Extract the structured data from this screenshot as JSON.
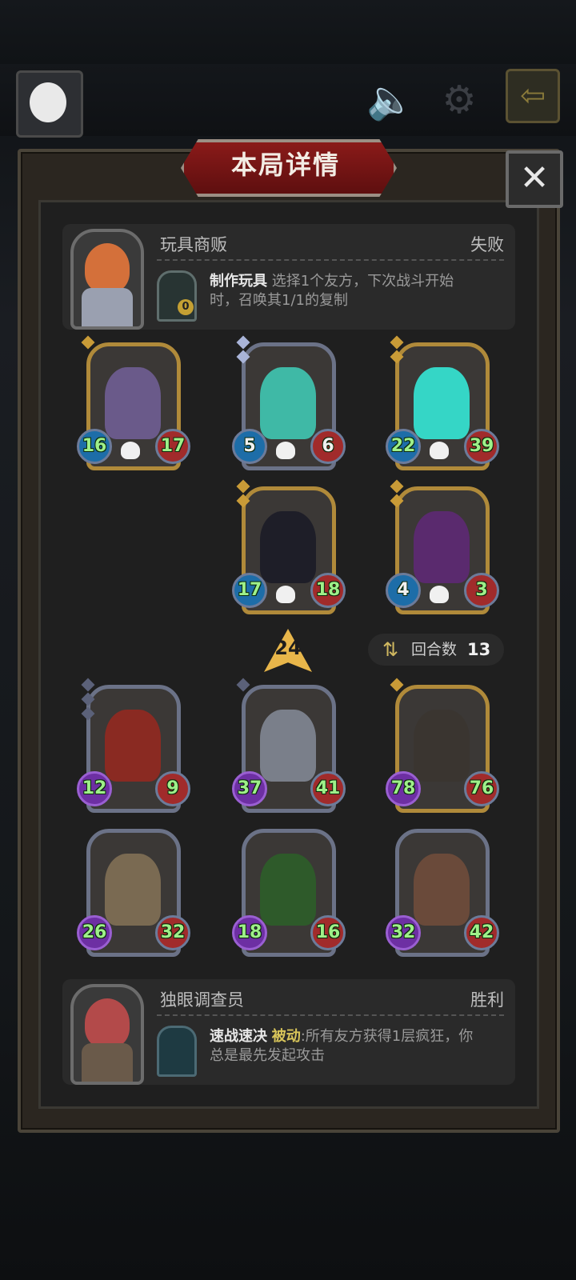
{
  "dialog": {
    "title": "本局详情",
    "close_label": "✕"
  },
  "top_bar": {
    "back_label": "⇦"
  },
  "opponent": {
    "name": "玩具商贩",
    "result": "失败",
    "skill_name": "制作玩具",
    "skill_desc": "选择1个友方，下次战斗开始时，召唤其1/1的复制",
    "skill_cost": "0"
  },
  "opponent_units": [
    {
      "atk": "16",
      "hp": "17"
    },
    {
      "atk": "5",
      "hp": "6"
    },
    {
      "atk": "22",
      "hp": "39"
    },
    {
      "atk": "17",
      "hp": "18"
    },
    {
      "atk": "4",
      "hp": "3"
    }
  ],
  "level": "24",
  "rounds": {
    "label": "回合数",
    "value": "13"
  },
  "player_units": [
    {
      "atk": "12",
      "hp": "9"
    },
    {
      "atk": "37",
      "hp": "41"
    },
    {
      "atk": "78",
      "hp": "76"
    },
    {
      "atk": "26",
      "hp": "32"
    },
    {
      "atk": "18",
      "hp": "16"
    },
    {
      "atk": "32",
      "hp": "42"
    }
  ],
  "player": {
    "name": "独眼调查员",
    "result": "胜利",
    "skill_name": "速战速决",
    "skill_tag": "被动",
    "skill_desc": ":所有友方获得1层疯狂，你总是最先发起攻击"
  },
  "icons": [
    "avatar-icon",
    "mute-icon",
    "settings-icon",
    "back-icon",
    "close-icon",
    "skull-icon",
    "round-icon",
    "level-icon"
  ],
  "colors": {
    "banner": "#8a1a19",
    "gold_frame": "#b08a3a",
    "silver_frame": "#6b7287",
    "stat_text": "#9ef089"
  }
}
